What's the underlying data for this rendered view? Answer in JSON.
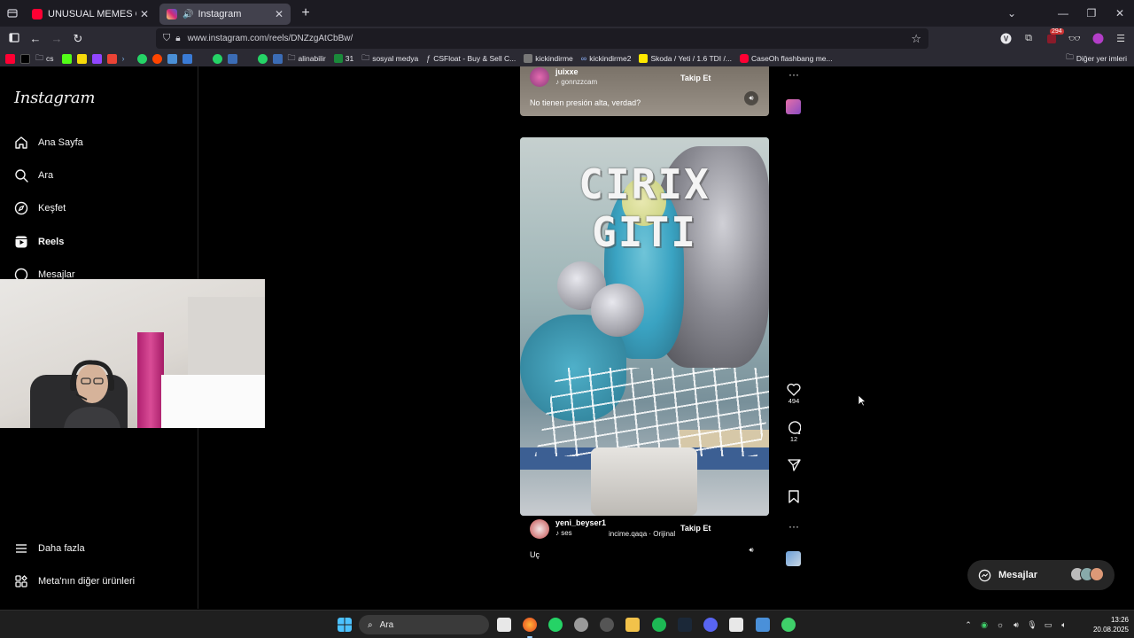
{
  "browser": {
    "tabs": [
      {
        "title": "UNUSUAL MEMES COMPILATIC",
        "favicon_color": "#ff0033",
        "active": false
      },
      {
        "title": "Instagram",
        "favicon_color": "#d62976",
        "active": true
      }
    ],
    "url": "www.instagram.com/reels/DNZzgAtCbBw/",
    "extension_badge": "294",
    "bookmarks": [
      {
        "label": "cs",
        "type": "folder"
      },
      {
        "label": "alinabilir",
        "type": "folder"
      },
      {
        "label": "31",
        "type": "link"
      },
      {
        "label": "sosyal medya",
        "type": "folder"
      },
      {
        "label": "CSFloat - Buy & Sell C...",
        "type": "link"
      },
      {
        "label": "kickindirme",
        "type": "link"
      },
      {
        "label": "kickindirme2",
        "type": "link"
      },
      {
        "label": "Skoda / Yeti / 1.6 TDI /...",
        "type": "link"
      },
      {
        "label": "CaseOh flashbang me...",
        "type": "link"
      }
    ],
    "other_bookmarks": "Diğer yer imleri"
  },
  "sidebar": {
    "logo": "Instagram",
    "items": [
      {
        "label": "Ana Sayfa",
        "icon": "home-icon"
      },
      {
        "label": "Ara",
        "icon": "search-icon"
      },
      {
        "label": "Keşfet",
        "icon": "compass-icon"
      },
      {
        "label": "Reels",
        "icon": "reels-icon"
      },
      {
        "label": "Mesajlar",
        "icon": "messenger-icon"
      }
    ],
    "bottom_items": [
      {
        "label": "Daha fazla",
        "icon": "menu-icon"
      },
      {
        "label": "Meta'nın diğer ürünleri",
        "icon": "grid-icon"
      }
    ]
  },
  "reel_prev": {
    "username": "juixxe",
    "sub": "gonnzzcam",
    "follow": "Takip Et",
    "caption": "No tienen presión alta, verdad?"
  },
  "reel_current": {
    "overlay_text": "CIRIX GITI",
    "username": "yeni_beyser1",
    "audio": "ses",
    "audio_credit": "incime.qaqa · Orijinal",
    "follow": "Takip Et",
    "caption": "Uç",
    "likes": "494",
    "comments": "12"
  },
  "messages_pill": {
    "label": "Mesajlar"
  },
  "taskbar": {
    "search_placeholder": "Ara",
    "time": "13:26",
    "date": "20.08.2025"
  },
  "colors": {
    "instagram_bg": "#000000",
    "browser_tab_bg": "#1c1b22",
    "browser_toolbar_bg": "#2b2a33",
    "messages_pill_bg": "#262626"
  }
}
